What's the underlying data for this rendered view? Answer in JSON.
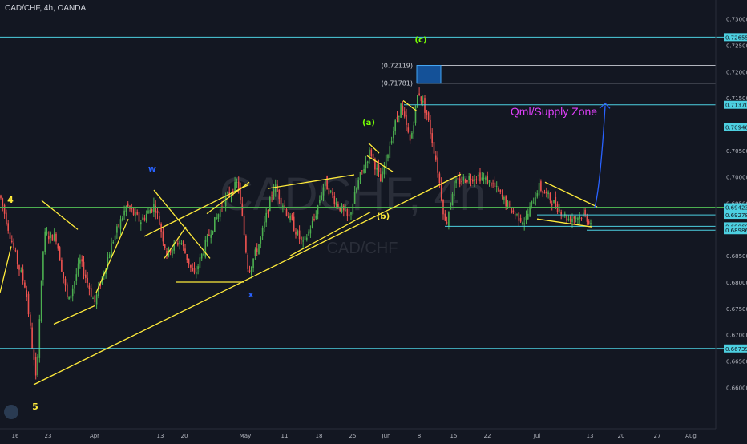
{
  "header": {
    "title": "CAD/CHF, 4h, OANDA"
  },
  "watermark": {
    "symbol": "CADCHF, 4h",
    "pair": "CAD/CHF"
  },
  "colors": {
    "background": "#131722",
    "bull": "#26a69a",
    "bull_candle": "#4caf50",
    "bear_candle": "#ef5350",
    "trendline": "#ffeb3b",
    "hline": "#4dd0e1",
    "box": "#1565c0",
    "arrow": "#2962ff",
    "zone_label": "#e040fb",
    "axis_text": "#b2b5be"
  },
  "chart_data": {
    "type": "candlestick",
    "symbol": "CAD/CHF",
    "timeframe": "4h",
    "broker": "OANDA",
    "ylim": [
      0.657,
      0.733
    ],
    "y_ticks": [
      "0.73000",
      "0.72500",
      "0.72000",
      "0.71500",
      "0.71000",
      "0.70500",
      "0.70000",
      "0.69500",
      "0.69000",
      "0.68500",
      "0.68000",
      "0.67500",
      "0.67000",
      "0.66500",
      "0.66000"
    ],
    "x_ticks": [
      "16",
      "23",
      "Apr",
      "13",
      "20",
      "May",
      "11",
      "18",
      "25",
      "Jun",
      "8",
      "15",
      "22",
      "Jul",
      "13",
      "20",
      "27",
      "Aug"
    ],
    "price_tags": [
      {
        "label": "0.72655",
        "value": 0.72655
      },
      {
        "label": "0.71370",
        "value": 0.7137
      },
      {
        "label": "0.70946",
        "value": 0.70946
      },
      {
        "label": "0.69423",
        "value": 0.69423
      },
      {
        "label": "0.69278",
        "value": 0.69278
      },
      {
        "label": "0.69060",
        "value": 0.6906
      },
      {
        "label": "0.68986",
        "value": 0.68986
      },
      {
        "label": "0.66739",
        "value": 0.66739
      }
    ],
    "box_levels": [
      {
        "label": "(0.72119)",
        "value": 0.72119
      },
      {
        "label": "(0.71781)",
        "value": 0.71781
      }
    ],
    "wave_labels": [
      "4",
      "5",
      "w",
      "x",
      "(a)",
      "(b)",
      "(c)"
    ],
    "annotation": "Qml/Supply Zone",
    "legend": "none",
    "grid": false
  }
}
